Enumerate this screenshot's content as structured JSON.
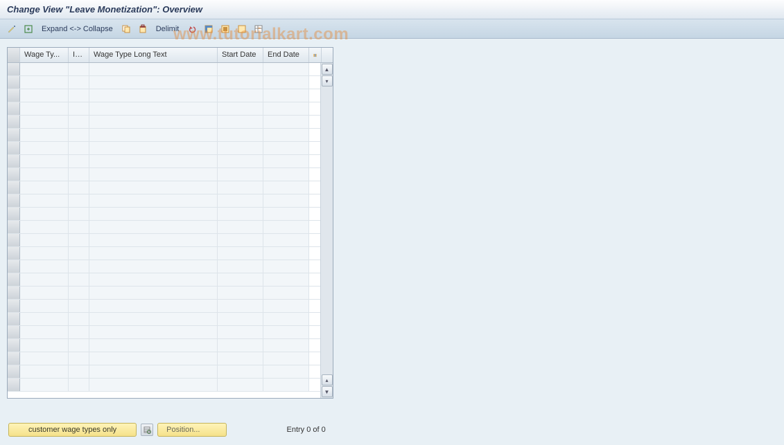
{
  "title": "Change View \"Leave Monetization\": Overview",
  "toolbar": {
    "expand_label": "Expand <-> Collapse",
    "delimit_label": "Delimit"
  },
  "table": {
    "columns": {
      "wage_type": "Wage Ty...",
      "inf": "Inf...",
      "long_text": "Wage Type Long Text",
      "start_date": "Start Date",
      "end_date": "End Date"
    },
    "row_count": 25,
    "rows": []
  },
  "footer": {
    "filter_button": "customer wage types only",
    "position_button": "Position...",
    "entry_text": "Entry 0 of 0"
  },
  "watermark": "www.tutorialkart.com"
}
